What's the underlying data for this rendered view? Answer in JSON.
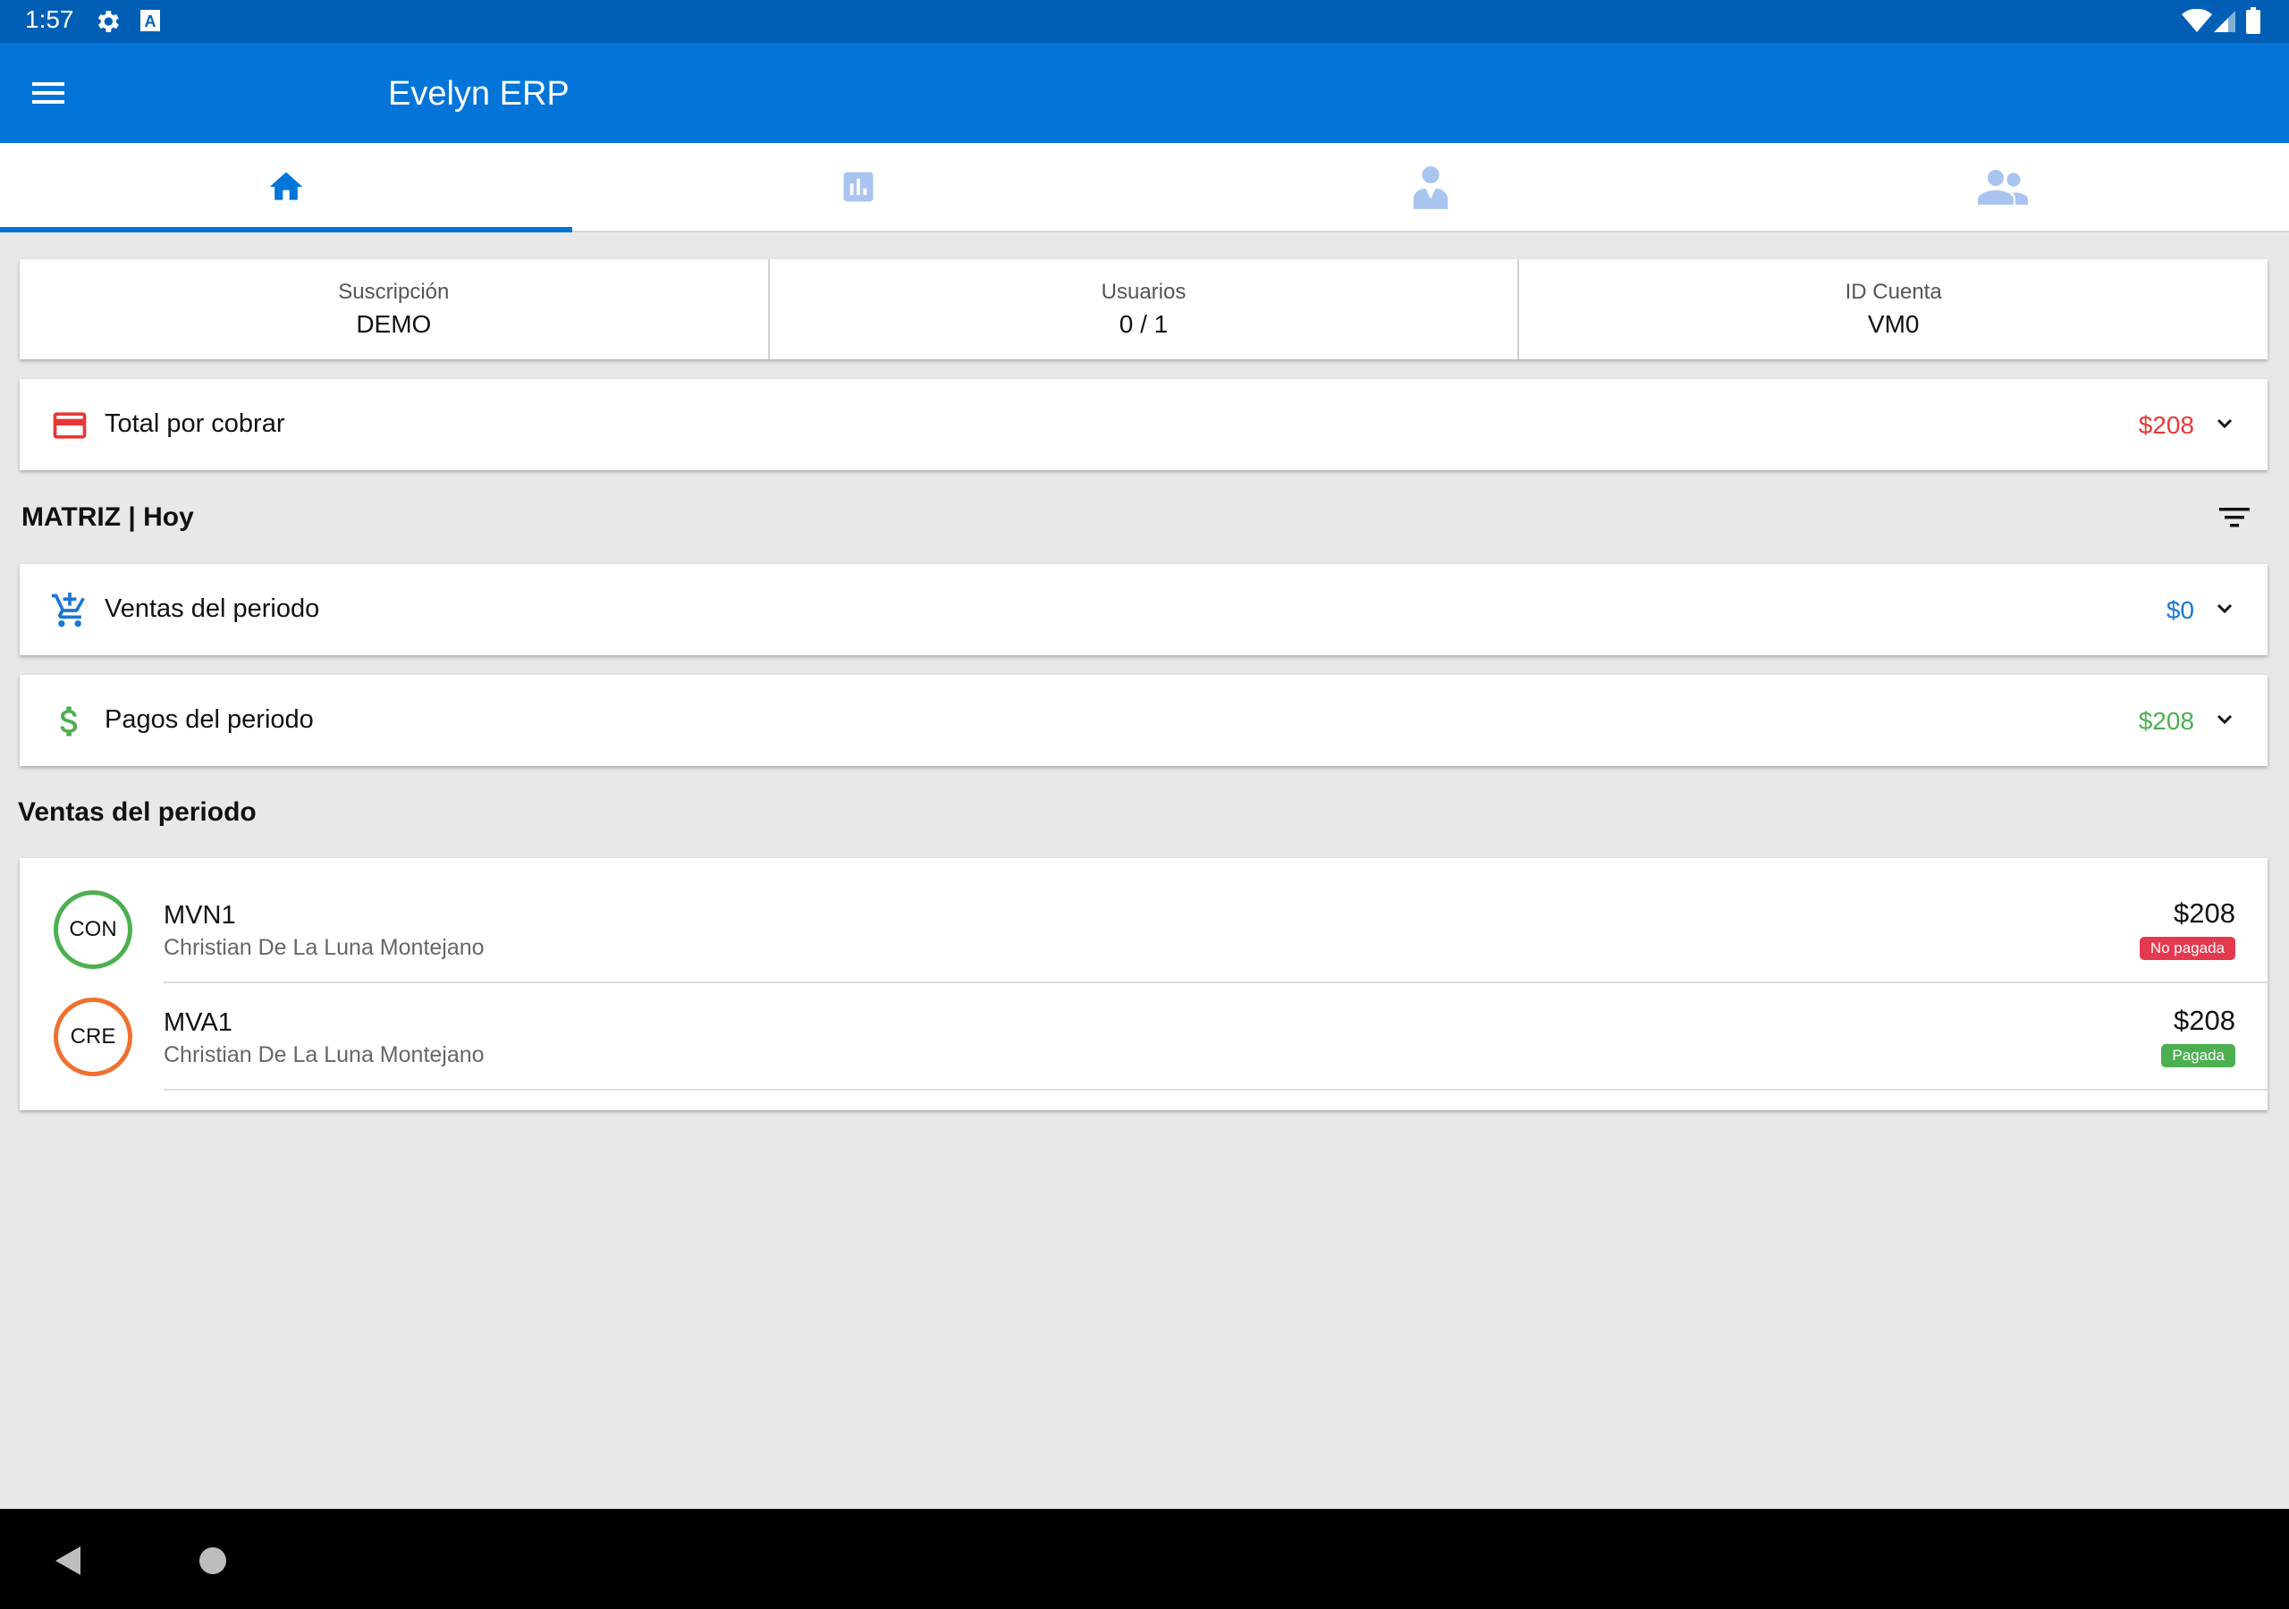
{
  "status_bar": {
    "time": "1:57",
    "icons": [
      "gear-icon",
      "text-a-icon",
      "wifi-icon",
      "signal-icon",
      "battery-icon"
    ]
  },
  "app_bar": {
    "title": "Evelyn ERP",
    "menu_icon": "hamburger-menu-icon"
  },
  "tabs": [
    {
      "icon": "home-icon",
      "selected": true
    },
    {
      "icon": "bar-chart-icon",
      "selected": false
    },
    {
      "icon": "person-icon",
      "selected": false
    },
    {
      "icon": "group-icon",
      "selected": false
    }
  ],
  "stats": [
    {
      "label": "Suscripción",
      "value": "DEMO"
    },
    {
      "label": "Usuarios",
      "value": "0 / 1"
    },
    {
      "label": "ID Cuenta",
      "value": "VM0"
    }
  ],
  "receivable": {
    "label": "Total por cobrar",
    "amount": "$208",
    "icon": "credit-card-icon",
    "color": "#e53935"
  },
  "filter_header": {
    "title": "MATRIZ | Hoy",
    "icon": "filter-list-icon"
  },
  "period_sales": {
    "label": "Ventas del periodo",
    "amount": "$0",
    "icon": "add-shopping-cart-icon",
    "color": "#1976d2"
  },
  "period_payments": {
    "label": "Pagos del periodo",
    "amount": "$208",
    "icon": "dollar-icon",
    "color": "#4caf50"
  },
  "sales_section": {
    "title": "Ventas del periodo"
  },
  "sales": [
    {
      "type": "CON",
      "type_color": "#4caf50",
      "folio": "MVN1",
      "customer": "Christian De La Luna Montejano",
      "amount": "$208",
      "status": "No pagada",
      "status_color": "#e53950"
    },
    {
      "type": "CRE",
      "type_color": "#f07030",
      "folio": "MVA1",
      "customer": "Christian De La Luna Montejano",
      "amount": "$208",
      "status": "Pagada",
      "status_color": "#4caf50"
    }
  ],
  "nav_bar": {
    "icons": [
      "back-icon",
      "home-circle-icon"
    ]
  },
  "colors": {
    "primary": "#0375d9",
    "status_bar": "#005fb5",
    "background": "#e8e8e8"
  }
}
